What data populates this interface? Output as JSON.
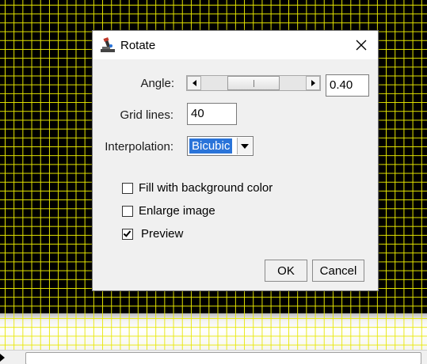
{
  "dialog": {
    "title": "Rotate",
    "app_icon": "imagej-microscope-icon",
    "close_icon": "close-icon"
  },
  "angle": {
    "label": "Angle:",
    "value": "0.40",
    "slider_position_fraction": 0.5
  },
  "grid_lines": {
    "label": "Grid lines:",
    "value": "40"
  },
  "interpolation": {
    "label": "Interpolation:",
    "selected": "Bicubic"
  },
  "checkboxes": {
    "fill_label": "Fill with background color",
    "fill_checked": false,
    "enlarge_label": "Enlarge image",
    "enlarge_checked": false,
    "preview_label": "Preview",
    "preview_checked": true
  },
  "buttons": {
    "ok": "OK",
    "cancel": "Cancel"
  },
  "colors": {
    "grid_line": "#e8e800",
    "canvas_background": "#000000",
    "selection_highlight": "#2a74d9"
  }
}
